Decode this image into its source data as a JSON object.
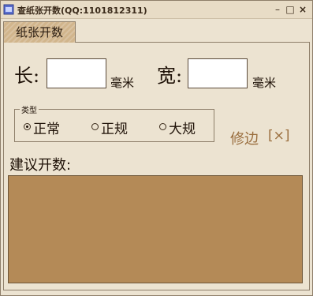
{
  "window": {
    "title": "查纸张开数(QQ:1101812311)",
    "icon": "app-icon",
    "controls": {
      "minimize": "–",
      "maximize": "□",
      "close": "×"
    }
  },
  "tabs": [
    {
      "label": "纸张开数",
      "active": true
    }
  ],
  "dimensions": {
    "length_label": "长:",
    "length_value": "",
    "length_unit": "毫米",
    "width_label": "宽:",
    "width_value": "",
    "width_unit": "毫米"
  },
  "type_group": {
    "legend": "类型",
    "options": [
      {
        "label": "正常",
        "selected": true
      },
      {
        "label": "正规",
        "selected": false
      },
      {
        "label": "大规",
        "selected": false
      }
    ]
  },
  "edge": {
    "label": "修边",
    "checkbox": "[×]"
  },
  "suggest": {
    "label": "建议开数:",
    "result": ""
  },
  "colors": {
    "background": "#ECE3D1",
    "result_area": "#B48A57",
    "link": "#9A6E3E",
    "tab": "#D1B58C"
  }
}
